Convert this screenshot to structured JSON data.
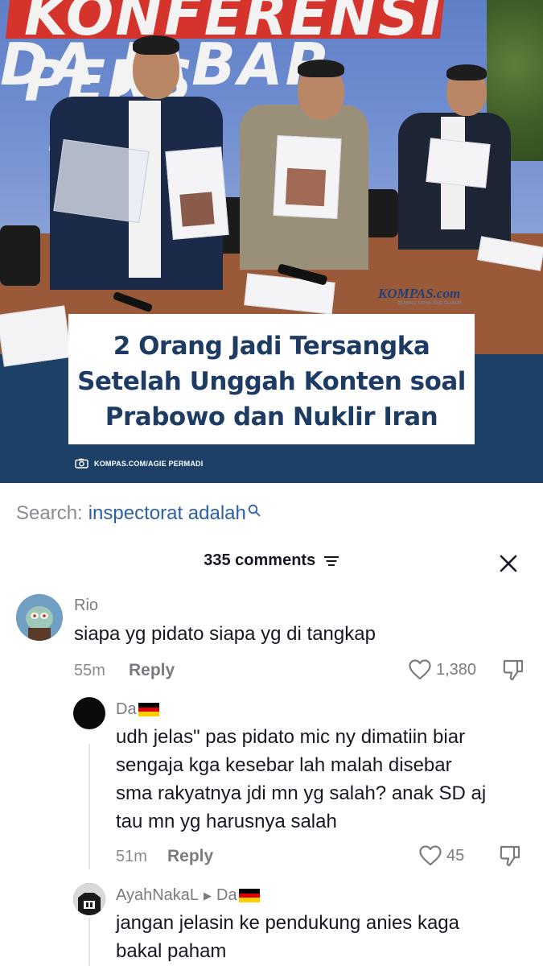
{
  "news": {
    "banner_line1": "KONFERENSI PERS",
    "banner_line2": "DA JABAR",
    "banner_line3": "2",
    "source_logo": "KOMPAS.com",
    "source_tagline": "BERBAGI JURNALISME SEJAGAT",
    "headline": "2 Orang Jadi Tersangka Setelah Unggah Konten soal Prabowo dan Nuklir Iran",
    "credit_icon": "camera-icon",
    "credit": "KOMPAS.COM/AGIE PERMADI"
  },
  "search": {
    "label": "Search:",
    "term": "inspectorat adalah",
    "icon": "search-icon"
  },
  "comments_panel": {
    "count_label": "335 comments",
    "sort_icon": "sort-icon",
    "close_icon": "close-icon"
  },
  "comments": [
    {
      "username": "Rio",
      "text": "siapa yg pidato siapa yg di tangkap",
      "time": "55m",
      "reply_label": "Reply",
      "likes": "1,380"
    },
    {
      "username": "Da",
      "flag": "🇩🇪",
      "text_lines": [
        "udh jelas\" pas pidato mic ny dimatiin biar",
        "sengaja kga kesebar lah malah disebar",
        "sma rakyatnya jdi mn yg salah? anak SD aj",
        "tau mn yg harusnya salah"
      ],
      "time": "51m",
      "reply_label": "Reply",
      "likes": "45"
    },
    {
      "username": "AyahNakaL",
      "reply_to": "Da",
      "flag": "🇩🇪",
      "text_lines": [
        "jangan jelasin ke pendukung anies kaga",
        "bakal paham"
      ]
    }
  ],
  "colors": {
    "search_term": "#2d5fa6",
    "headline": "#1e3b63",
    "text": "#161823",
    "muted": "#8a8b91"
  }
}
